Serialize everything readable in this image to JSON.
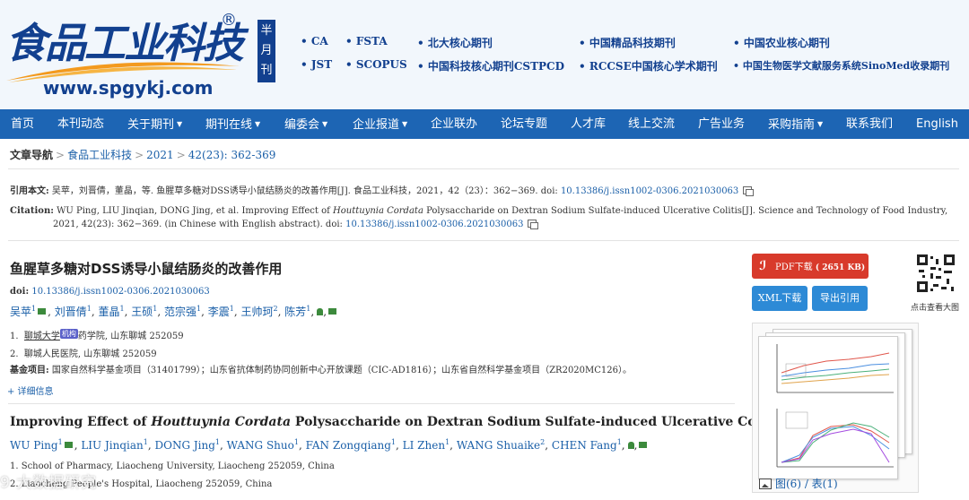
{
  "header": {
    "logo_cn": "食品工业科技",
    "logo_reg": "®",
    "logo_url": "www.spgykj.com",
    "frequency": [
      "半",
      "月",
      "刊"
    ],
    "indexes_row1": [
      "CA",
      "FSTA",
      "北大核心期刊",
      "中国精品科技期刊",
      "中国农业核心期刊"
    ],
    "indexes_row2": [
      "JST",
      "SCOPUS",
      "中国科技核心期刊CSTPCD",
      "RCCSE中国核心学术期刊",
      "中国生物医学文献服务系统SinoMed收录期刊"
    ]
  },
  "nav": [
    {
      "label": "首页",
      "dropdown": false
    },
    {
      "label": "本刊动态",
      "dropdown": false
    },
    {
      "label": "关于期刊",
      "dropdown": true
    },
    {
      "label": "期刊在线",
      "dropdown": true
    },
    {
      "label": "编委会",
      "dropdown": true
    },
    {
      "label": "企业报道",
      "dropdown": true
    },
    {
      "label": "企业联办",
      "dropdown": false
    },
    {
      "label": "论坛专题",
      "dropdown": false
    },
    {
      "label": "人才库",
      "dropdown": false
    },
    {
      "label": "线上交流",
      "dropdown": false
    },
    {
      "label": "广告业务",
      "dropdown": false
    },
    {
      "label": "采购指南",
      "dropdown": true
    },
    {
      "label": "联系我们",
      "dropdown": false
    },
    {
      "label": "English",
      "dropdown": false
    }
  ],
  "breadcrumb": {
    "label": "文章导航",
    "journal": "食品工业科技",
    "year": "2021",
    "issue": "42(23): 362-369"
  },
  "citation_cn": {
    "label": "引用本文:",
    "text": "吴苹，刘晋倩，董晶，等. 鱼腥草多糖对DSS诱导小鼠结肠炎的改善作用[J]. 食品工业科技，2021，42（23）：362−369. doi: ",
    "doi": "10.13386/j.issn1002-0306.2021030063"
  },
  "citation_en": {
    "label": "Citation:",
    "text_before": "WU Ping, LIU Jinqian, DONG Jing, et al. Improving Effect of ",
    "italic": "Houttuynia Cordata",
    "text_after": " Polysaccharide on Dextran Sodium Sulfate-induced Ulcerative Colitis[J]. Science and Technology of Food Industry, 2021, 42(23): 362−369. (in Chinese with English abstract). doi: ",
    "doi": "10.13386/j.issn1002-0306.2021030063"
  },
  "article": {
    "title_cn": "鱼腥草多糖对DSS诱导小鼠结肠炎的改善作用",
    "doi_label": "doi:",
    "doi": "10.13386/j.issn1002-0306.2021030063",
    "authors_cn": [
      {
        "name": "吴苹",
        "sup": "1",
        "mail": true
      },
      {
        "name": "刘晋倩",
        "sup": "1"
      },
      {
        "name": "董晶",
        "sup": "1"
      },
      {
        "name": "王硕",
        "sup": "1"
      },
      {
        "name": "范宗强",
        "sup": "1"
      },
      {
        "name": "李震",
        "sup": "1"
      },
      {
        "name": "王帅珂",
        "sup": "2"
      },
      {
        "name": "陈芳",
        "sup": "1"
      }
    ],
    "aff_cn": [
      {
        "num": "1.",
        "inst": "聊城大学",
        "badge": "机构",
        "rest": "药学院, 山东聊城 252059"
      },
      {
        "num": "2.",
        "inst": "聊城人民医院, 山东聊城 252059",
        "badge": "",
        "rest": ""
      }
    ],
    "fund_label": "基金项目:",
    "fund_text": "国家自然科学基金项目（31401799）；山东省抗体制药协同创新中心开放课题（CIC-AD1816）；山东省自然科学基金项目（ZR2020MC126）。",
    "more": "+ 详细信息",
    "title_en_before": "Improving Effect of ",
    "title_en_italic": "Houttuynia Cordata",
    "title_en_after": " Polysaccharide on Dextran Sodium Sulfate-induced Ulcerative Colitis",
    "authors_en": [
      {
        "name": "WU Ping",
        "sup": "1",
        "mail": true
      },
      {
        "name": "LIU Jinqian",
        "sup": "1"
      },
      {
        "name": "DONG Jing",
        "sup": "1"
      },
      {
        "name": "WANG Shuo",
        "sup": "1"
      },
      {
        "name": "FAN Zongqiang",
        "sup": "1"
      },
      {
        "name": "LI Zhen",
        "sup": "1"
      },
      {
        "name": "WANG Shuaike",
        "sup": "2"
      },
      {
        "name": "CHEN Fang",
        "sup": "1"
      }
    ],
    "aff_en": [
      "1. School of Pharmacy, Liaocheng University, Liaocheng 252059, China",
      "2. Liaocheng People's Hospital, Liaocheng 252059, China"
    ]
  },
  "sidebar": {
    "pdf_label": "PDF下载",
    "pdf_size": "( 2651 KB)",
    "xml_label": "XML下载",
    "export_label": "导出引用",
    "qr_label": "点击查看大图",
    "figures_label": "图(6)",
    "tables_label": "表(1)",
    "fig_sep": " / "
  },
  "watermark": "9 大数据研究",
  "colors": {
    "nav_bg": "#1d65b4",
    "link": "#1a5fa8",
    "pdf_btn": "#d83a2b",
    "blue_btn": "#2d8ad6",
    "header_bg": "#f2f7fc",
    "logo": "#12408f"
  }
}
